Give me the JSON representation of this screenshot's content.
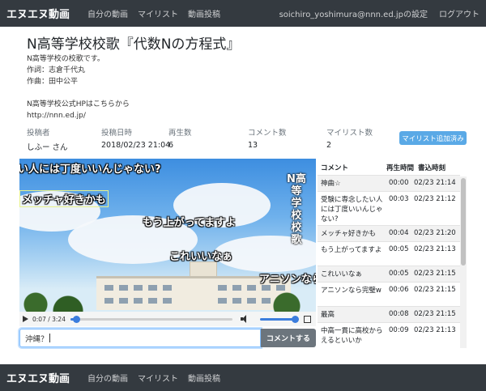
{
  "navbar": {
    "brand": "エヌエヌ動画",
    "links": [
      "自分の動画",
      "マイリスト",
      "動画投稿"
    ],
    "user_settings": "soichiro_yoshimura@nnn.ed.jpの設定",
    "logout": "ログアウト"
  },
  "video": {
    "title": "N高等学校校歌『代数Nの方程式』",
    "description": [
      "N高等学校の校歌です。",
      "作詞：志倉千代丸",
      "作曲：田中公平",
      "",
      "N高等学校公式HPはこちらから",
      "http://nnn.ed.jp/"
    ],
    "overlay_title": "N高等学校 校歌",
    "time_display": "0:07 / 3:24",
    "progress_fraction": 0.034,
    "volume_fraction": 1.0
  },
  "stats": {
    "headers": [
      "投稿者",
      "投稿日時",
      "再生数",
      "コメント数",
      "マイリスト数"
    ],
    "values": [
      "しふー さん",
      "2018/02/23 21:04",
      "6",
      "13",
      "2"
    ]
  },
  "mylist_button": "マイリスト追加済み",
  "danmaku": [
    "い人には丁度いいんじゃない?",
    "メッチャ好きかも",
    "もう上がってますよ",
    "これいいなぁ",
    "アニソンなら"
  ],
  "comment_form": {
    "value": "沖縄？",
    "submit_label": "コメントする"
  },
  "comment_list": {
    "headers": [
      "コメント",
      "再生時間",
      "書込時刻"
    ],
    "rows": [
      {
        "text": "神曲☆",
        "time": "00:00",
        "posted": "02/23 21:14"
      },
      {
        "text": "受験に専念したい人には丁度いいんじゃない?",
        "time": "00:03",
        "posted": "02/23 21:12"
      },
      {
        "text": "メッチャ好きかも",
        "time": "00:04",
        "posted": "02/23 21:20"
      },
      {
        "text": "もう上がってますよ",
        "time": "00:05",
        "posted": "02/23 21:13"
      },
      {
        "text": "これいいなぁ",
        "time": "00:05",
        "posted": "02/23 21:15"
      },
      {
        "text": "アニソンなら完璧w",
        "time": "00:06",
        "posted": "02/23 21:15"
      },
      {
        "text": "最高",
        "time": "00:08",
        "posted": "02/23 21:15"
      },
      {
        "text": "中高一貫に高校からえるといいか",
        "time": "00:09",
        "posted": "02/23 21:13"
      }
    ]
  },
  "colors": {
    "navbar": "#343a40",
    "mylist_button": "#5aa9e6",
    "comment_button": "#6c757d",
    "seek": "#3b7ddd"
  }
}
